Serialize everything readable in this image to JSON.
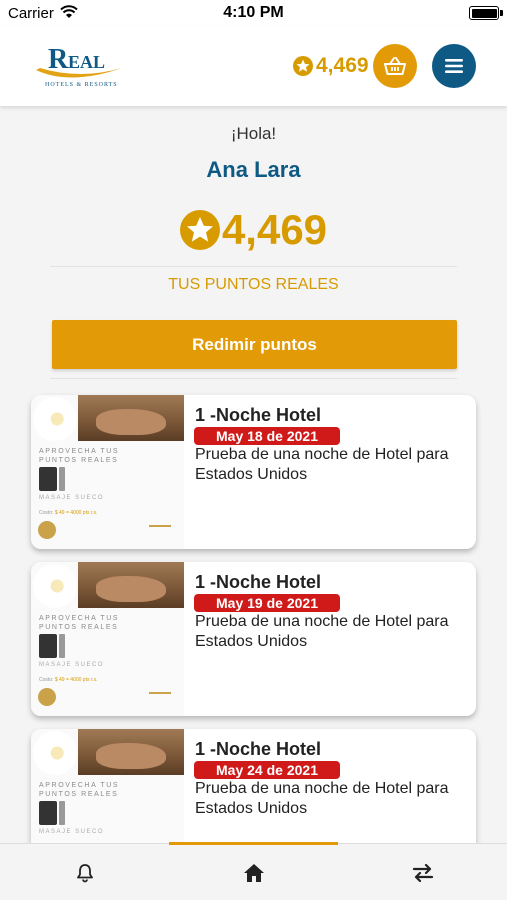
{
  "status_bar": {
    "carrier": "Carrier",
    "time": "4:10 PM"
  },
  "header": {
    "logo_text": "REAL",
    "logo_subtitle": "Hotels & Resorts",
    "points": "4,469"
  },
  "profile": {
    "greeting": "¡Hola!",
    "name": "Ana Lara",
    "points": "4,469",
    "points_label": "TUS PUNTOS REALES"
  },
  "actions": {
    "redeem_label": "Redimir puntos"
  },
  "rewards": [
    {
      "title": "1 -Noche Hotel",
      "date": "May 18 de 2021",
      "description": "Prueba de una noche de Hotel para Estados Unidos"
    },
    {
      "title": "1 -Noche Hotel",
      "date": "May 19 de 2021",
      "description": "Prueba de una noche de Hotel para Estados Unidos"
    },
    {
      "title": "1 -Noche Hotel",
      "date": "May 24 de 2021",
      "description": "Prueba de una noche de Hotel para Estados Unidos"
    }
  ],
  "thumbnail": {
    "promo_line1": "APROVECHA TUS",
    "promo_line2": "PUNTOS REALES",
    "massage_label": "MASAJE SUECO",
    "cost_label": "Costo:",
    "cost_value": "$ 49 = 4000 pts r.s."
  },
  "tab_bar": {
    "items": [
      {
        "icon": "bell-icon"
      },
      {
        "icon": "home-icon",
        "active": true
      },
      {
        "icon": "transfer-icon"
      }
    ]
  },
  "colors": {
    "gold": "#e29a06",
    "gold_text": "#d79b00",
    "navy": "#0e5a85",
    "date_red": "#d01a1a"
  }
}
